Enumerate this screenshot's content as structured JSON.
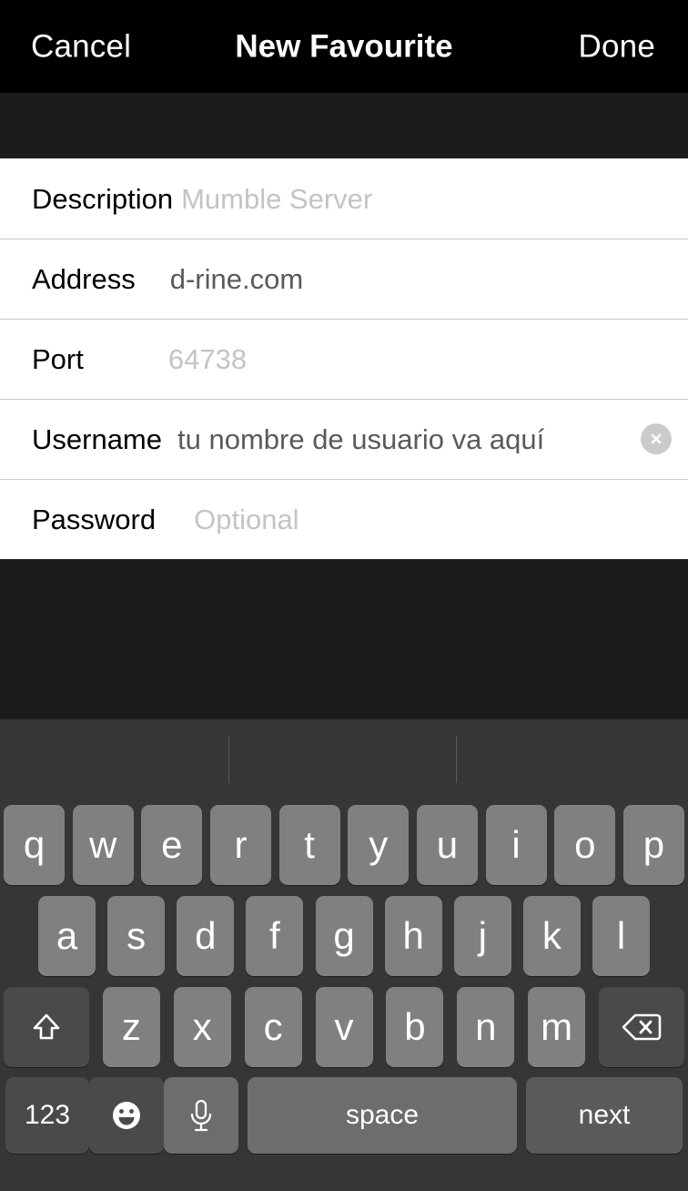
{
  "navbar": {
    "cancel_label": "Cancel",
    "title": "New Favourite",
    "done_label": "Done"
  },
  "form": {
    "rows": [
      {
        "label": "Description",
        "value": "Mumble Server",
        "state": "placeholder",
        "clear_button": false
      },
      {
        "label": "Address",
        "value": "d-rine.com",
        "state": "filled",
        "clear_button": false
      },
      {
        "label": "Port",
        "value": "64738",
        "state": "placeholder",
        "clear_button": false
      },
      {
        "label": "Username",
        "value": "tu nombre de usuario va aquí",
        "state": "filled",
        "clear_button": true
      },
      {
        "label": "Password",
        "value": "Optional",
        "state": "placeholder",
        "clear_button": false
      }
    ]
  },
  "keyboard": {
    "predictive_suggestions": [],
    "row1": [
      "q",
      "w",
      "e",
      "r",
      "t",
      "y",
      "u",
      "i",
      "o",
      "p"
    ],
    "row2": [
      "a",
      "s",
      "d",
      "f",
      "g",
      "h",
      "j",
      "k",
      "l"
    ],
    "row3": [
      "z",
      "x",
      "c",
      "v",
      "b",
      "n",
      "m"
    ],
    "shift_icon": "shift-arrow-up-icon",
    "backspace_icon": "delete-left-icon",
    "numbers_label": "123",
    "emoji_icon": "smiley-face-icon",
    "dictation_icon": "microphone-icon",
    "space_label": "space",
    "return_label": "next"
  },
  "colors": {
    "navbar_background": "#000000",
    "page_background": "#1c1c1c",
    "table_background": "#ffffff",
    "separator": "#c8c7cc",
    "placeholder_text": "#c3c3c8",
    "filled_text": "#5a5a5a",
    "label_text": "#000000",
    "keyboard_background": "#363636",
    "key_letter": "#808080",
    "key_dark": "#4a4a4a",
    "key_return": "#5a5a5a",
    "key_space": "#6d6d6d",
    "clear_button": "#cbcbcb"
  }
}
